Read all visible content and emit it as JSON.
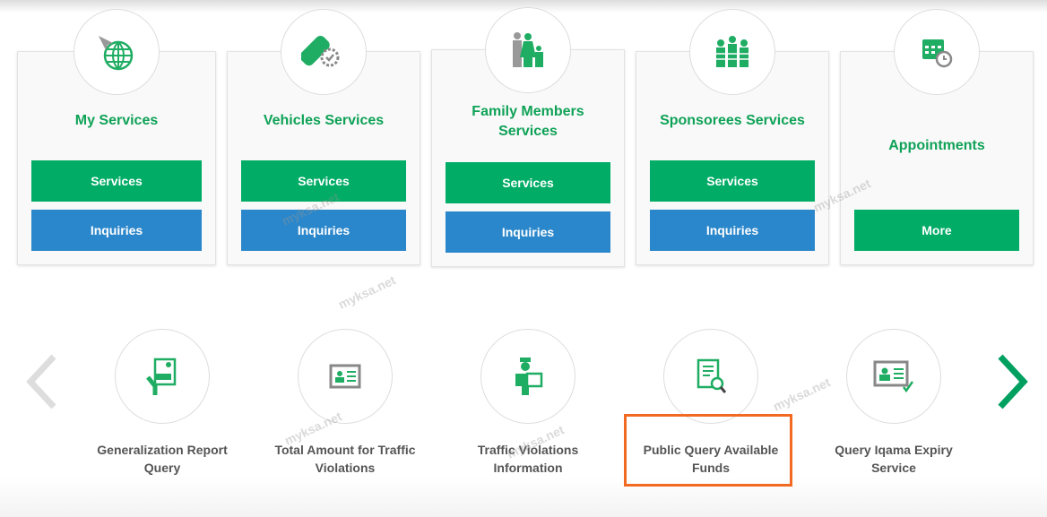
{
  "cards": [
    {
      "title": "My Services",
      "icon": "globe-icon",
      "buttons": [
        "Services",
        "Inquiries"
      ]
    },
    {
      "title": "Vehicles Services",
      "icon": "vehicle-gear-icon",
      "buttons": [
        "Services",
        "Inquiries"
      ]
    },
    {
      "title": "Family Members Services",
      "icon": "family-icon",
      "buttons": [
        "Services",
        "Inquiries"
      ]
    },
    {
      "title": "Sponsorees Services",
      "icon": "workers-icon",
      "buttons": [
        "Services",
        "Inquiries"
      ]
    },
    {
      "title": "Appointments",
      "icon": "calendar-clock-icon",
      "buttons": [
        "More"
      ]
    }
  ],
  "carousel": {
    "items": [
      {
        "label": "Generalization Report Query",
        "icon": "certificate-hand-icon"
      },
      {
        "label": "Total Amount for Traffic Violations",
        "icon": "id-card-icon"
      },
      {
        "label": "Traffic Violations Information",
        "icon": "traffic-officer-icon"
      },
      {
        "label": "Public Query Available Funds",
        "icon": "document-money-search-icon",
        "highlighted": true
      },
      {
        "label": "Query Iqama Expiry Service",
        "icon": "id-card-check-icon"
      }
    ],
    "prev_icon": "chevron-left-icon",
    "next_icon": "chevron-right-icon"
  },
  "watermark": "myksa.net",
  "colors": {
    "green": "#00ac66",
    "blue": "#2b87cb",
    "title_green": "#0fa257",
    "highlight": "#f26a21"
  }
}
